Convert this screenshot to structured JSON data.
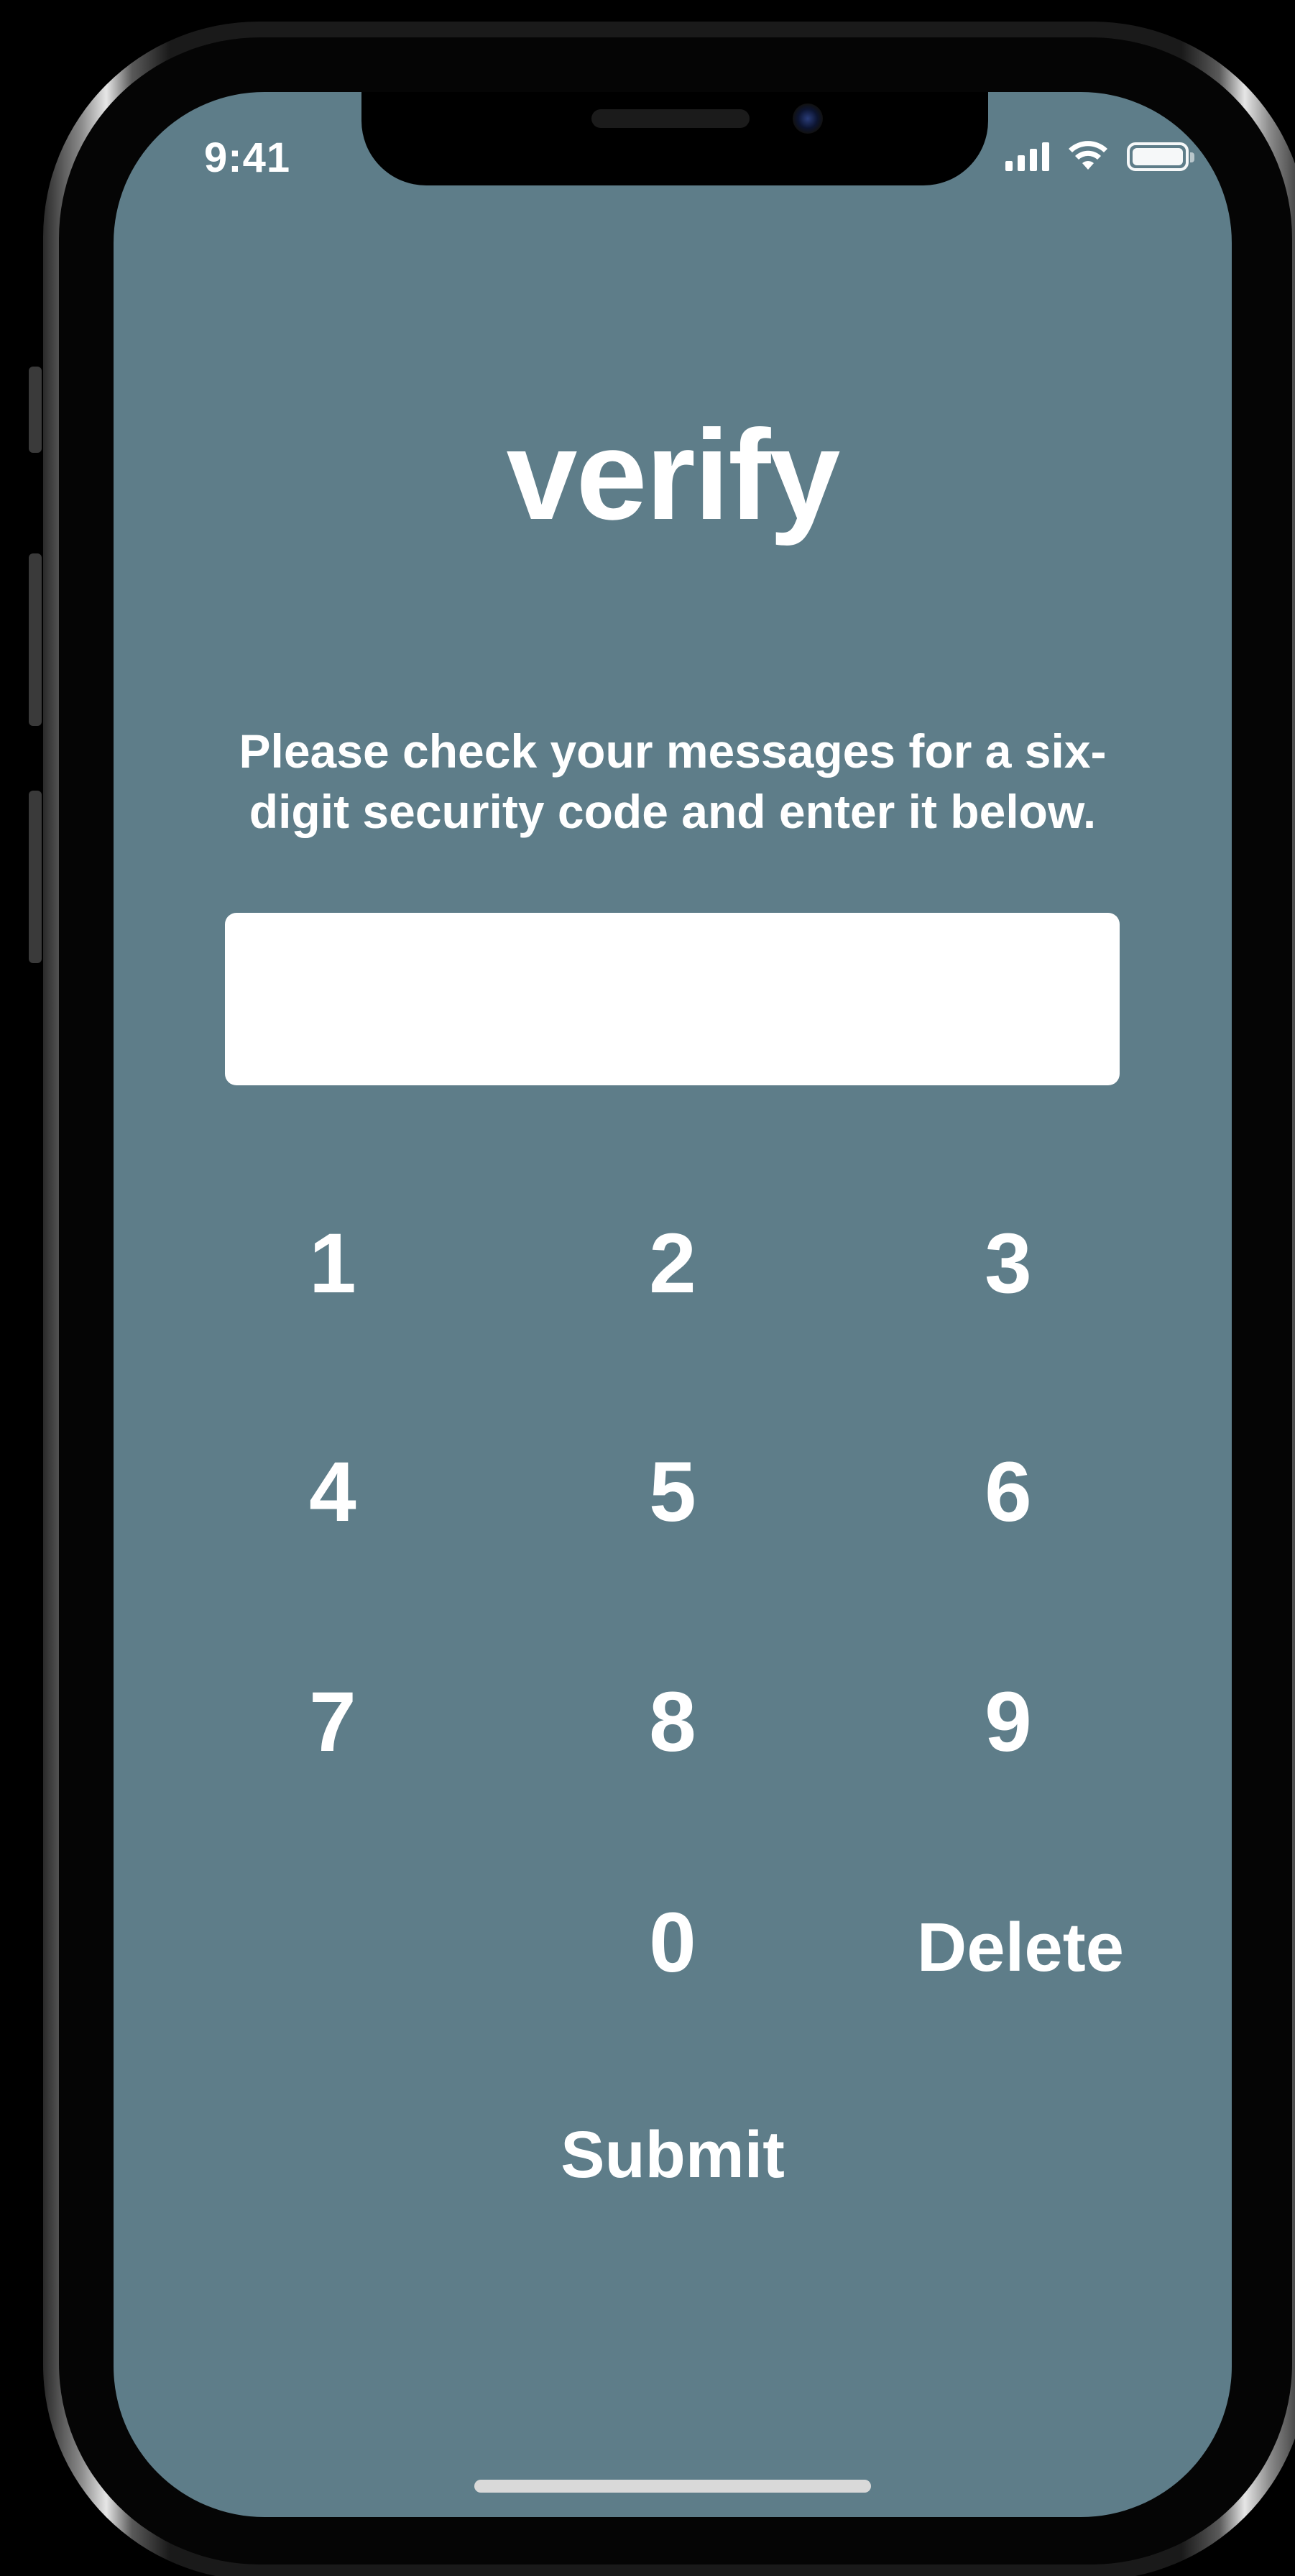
{
  "status_bar": {
    "time": "9:41",
    "icons": [
      "cellular-signal-icon",
      "wifi-icon",
      "battery-icon"
    ]
  },
  "screen": {
    "title": "verify",
    "instructions": "Please check your messages for a six-digit security code and enter it below.",
    "code_input": {
      "value": "",
      "placeholder": ""
    }
  },
  "keypad": {
    "keys": [
      "1",
      "2",
      "3",
      "4",
      "5",
      "6",
      "7",
      "8",
      "9",
      "0"
    ],
    "delete_label": "Delete"
  },
  "submit_label": "Submit",
  "colors": {
    "screen_background": "#5e7d89",
    "text": "#ffffff",
    "input_background": "#ffffff"
  }
}
